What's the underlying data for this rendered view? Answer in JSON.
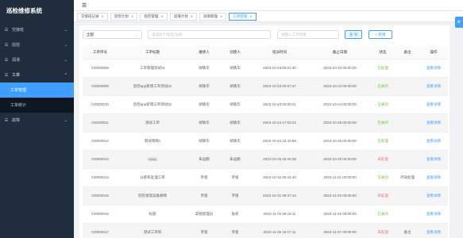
{
  "app": {
    "title": "巡检维修系统"
  },
  "sidebar": {
    "items": [
      {
        "label": "交接班",
        "icon": "menu-icon"
      },
      {
        "label": "巡检",
        "icon": "menu-icon"
      },
      {
        "label": "润滑",
        "icon": "menu-icon"
      },
      {
        "label": "工单",
        "icon": "menu-icon",
        "open": true,
        "children": [
          {
            "label": "工单管理",
            "active": true
          },
          {
            "label": "工单统计"
          }
        ]
      },
      {
        "label": "故障",
        "icon": "menu-icon"
      }
    ]
  },
  "tabs": [
    {
      "label": "交接班记录"
    },
    {
      "label": "巡检计划"
    },
    {
      "label": "巡检管理"
    },
    {
      "label": "润滑计划"
    },
    {
      "label": "润滑管理"
    },
    {
      "label": "工单管理",
      "active": true
    }
  ],
  "filters": {
    "status_select": "全部",
    "keyword_placeholder": "请选择产线/区/设备",
    "user_placeholder": "请输入工单创建",
    "search_label": "查 询",
    "add_label": "+ 新增"
  },
  "table": {
    "headers": [
      "工单序号",
      "工单标题",
      "维修人",
      "创建人",
      "指派时间",
      "截止日期",
      "状态",
      "备注",
      "操作"
    ],
    "rows": [
      [
        "GD000008",
        "工单管理测试01",
        "胡轶华",
        "胡轶华",
        "2023-10-23 00:01:30",
        "2023-10-23 00:00:00",
        "已处理",
        "",
        "查看详情"
      ],
      [
        "GD000009",
        "巡检app新增工单测试01",
        "胡轶华",
        "胡轶华",
        "2023-10-23 00:07:47",
        "2023-10-23 00:00:00",
        "已关闭",
        "",
        "查看详情"
      ],
      [
        "GD000010",
        "巡检app新增工单测试01",
        "胡轶华",
        "胡轶华",
        "2023-10-23 00:09:21",
        "2023-10-24 00:00:00",
        "已关闭",
        "",
        "查看详情"
      ],
      [
        "GD000011",
        "测试工单",
        "胡轶华",
        "胡轶华",
        "2023-10-24 17:03:23",
        "2023-10-25 00:00:00",
        "已关闭",
        "",
        "查看详情"
      ],
      [
        "GD000012",
        "测试保障1",
        "胡轶华",
        "胡轶华",
        "2023-10-24 23:43:56",
        "2023-10-25 00:00:00",
        "已处理",
        "",
        "查看详情"
      ],
      [
        "GD000013",
        "jsjsjsj",
        "朱益鹏",
        "朱益鹏",
        "2023-10-25 18:46:39",
        "2023-10-25 00:00:00",
        "未处理",
        "",
        "查看详情"
      ],
      [
        "GD000014",
        "分拣机处理工单",
        "罗俊",
        "罗俊",
        "2023-10-31 09:44:40",
        "2023-11-01 00:00:00",
        "已关闭",
        "尽快处理",
        "查看详情"
      ],
      [
        "GD000015",
        "巡检发现设备故障",
        "罗俊",
        "罗俊",
        "2023-10-31 09:47:44",
        "2023-11-02 00:00:00",
        "未处理",
        "",
        "查看详情"
      ],
      [
        "GD000016",
        "标题",
        "高铭管理员",
        "张权",
        "2023-11-02 09:19:11",
        "2023-11-02 00:00:00",
        "已关闭",
        "",
        "查看详情"
      ],
      [
        "GD000017",
        "测试工单筒",
        "罗俊",
        "罗俊",
        "2023-11-06 15:17:11",
        "2023-11-07 00:00:00",
        "未处理",
        "备注",
        "查看详情"
      ]
    ]
  },
  "colors": {
    "accent": "#409eff",
    "sidebar": "#1f2d3d",
    "open": "#67c23a",
    "closed": "#f56c6c"
  }
}
